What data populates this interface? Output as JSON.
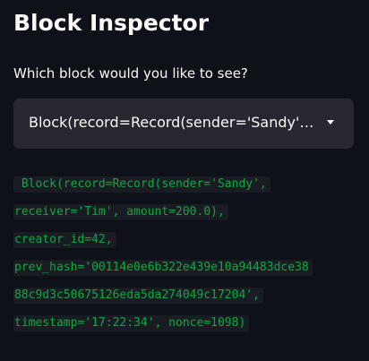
{
  "page": {
    "title": "Block Inspector"
  },
  "selector": {
    "label": "Which block would you like to see?",
    "value": "Block(record=Record(sender='Sandy', receiver='Tim', amount=200.0), creator_id=42, prev_hash='00114e0e6b322e439e10a94483dce3888c9d3c50675126eda5da274049c17204', timestamp='17:22:34', nonce=1098)",
    "icon": "chevron-down-icon"
  },
  "output": {
    "lines": [
      " Block(record=Record(sender='Sandy',",
      "receiver='Tim', amount=200.0),",
      "creator_id=42,",
      "prev_hash='00114e0e6b322e439e10a94483dce38",
      "88c9d3c50675126eda5da274049c17204',",
      "timestamp='17:22:34', nonce=1098)"
    ]
  },
  "colors": {
    "background": "#0e1117",
    "select_background": "#262730",
    "text": "#fafafa",
    "code_text": "#09ab3b",
    "code_background": "#1a1c24"
  }
}
